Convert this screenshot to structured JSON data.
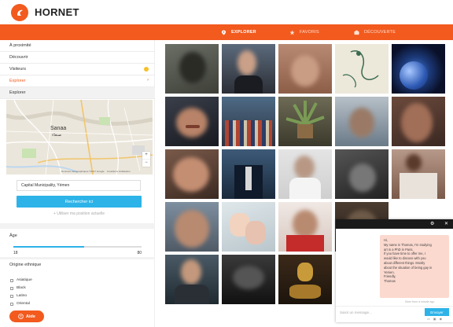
{
  "app": {
    "name": "HORNET",
    "brand_color": "#f25a1e",
    "accent_color": "#2db3e8"
  },
  "nav": {
    "items": [
      {
        "label": "EXPLORER",
        "icon": "location-pin-icon",
        "active": true
      },
      {
        "label": "FAVORIS",
        "icon": "star-icon",
        "active": false
      },
      {
        "label": "DÉCOUVERTE",
        "icon": "compass-icon",
        "active": false
      }
    ]
  },
  "sidebar": {
    "items": [
      {
        "label": "À proximité"
      },
      {
        "label": "Découvrir"
      },
      {
        "label": "Visiteurs",
        "badge": "yellow-dot"
      },
      {
        "label": "Explorer",
        "active": true,
        "chevron": "›"
      }
    ],
    "explore_header": "Explorer",
    "map": {
      "city_label": "Sanaa",
      "city_label_ar": "صنعاء",
      "zoom_in": "+",
      "zoom_out": "−",
      "attribution": "Données cartographiques ©2017 Google    Conditions d'utilisation"
    },
    "location_value": "Capital Municipality, Yémen",
    "search_button": "Rechercher ici",
    "use_position": "+ Utiliser ma position actuelle",
    "age": {
      "label": "Âge",
      "min": "18",
      "max": "80",
      "fill_fraction": 0.55
    },
    "ethnicity": {
      "label": "Origine ethnique",
      "options": [
        "Asiatique",
        "Black",
        "Latino",
        "Oriental"
      ]
    },
    "help_button": "Aide"
  },
  "chat": {
    "message": [
      "Hi,",
      "My name is Thomas, I'm studying",
      "art in a PhD in Paris.",
      "If you have time to offer me, I",
      "would like to discuss with you",
      "about different things. Mostly",
      "about the situation of being gay in",
      "Yemen.",
      "Friendly,",
      "Thomas"
    ],
    "meta": "Seen from a minute ago",
    "placeholder": "Saisir un message...",
    "send": "Envoyer"
  }
}
